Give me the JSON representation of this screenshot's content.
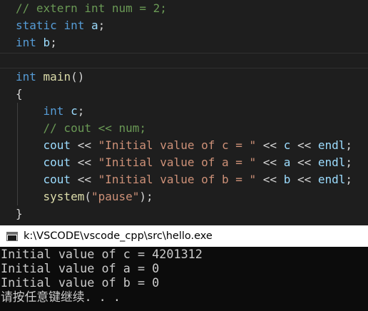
{
  "editor": {
    "lines": [
      {
        "tokens": [
          {
            "t": "// extern int num = 2;",
            "c": "cmt"
          }
        ]
      },
      {
        "tokens": [
          {
            "t": "static",
            "c": "kw"
          },
          {
            "t": " ",
            "c": "pun"
          },
          {
            "t": "int",
            "c": "kw"
          },
          {
            "t": " ",
            "c": "pun"
          },
          {
            "t": "a",
            "c": "var"
          },
          {
            "t": ";",
            "c": "pun"
          }
        ]
      },
      {
        "tokens": [
          {
            "t": "int",
            "c": "kw"
          },
          {
            "t": " ",
            "c": "pun"
          },
          {
            "t": "b",
            "c": "var"
          },
          {
            "t": ";",
            "c": "pun"
          }
        ]
      },
      {
        "tokens": []
      },
      {
        "tokens": [
          {
            "t": "int",
            "c": "kw"
          },
          {
            "t": " ",
            "c": "pun"
          },
          {
            "t": "main",
            "c": "fn"
          },
          {
            "t": "()",
            "c": "pun"
          }
        ]
      },
      {
        "tokens": [
          {
            "t": "{",
            "c": "pun"
          }
        ]
      },
      {
        "tokens": [
          {
            "t": "    ",
            "c": "pun"
          },
          {
            "t": "int",
            "c": "kw"
          },
          {
            "t": " ",
            "c": "pun"
          },
          {
            "t": "c",
            "c": "var"
          },
          {
            "t": ";",
            "c": "pun"
          }
        ]
      },
      {
        "tokens": [
          {
            "t": "    ",
            "c": "pun"
          },
          {
            "t": "// cout << num;",
            "c": "cmt"
          }
        ]
      },
      {
        "tokens": [
          {
            "t": "    ",
            "c": "pun"
          },
          {
            "t": "cout",
            "c": "var"
          },
          {
            "t": " << ",
            "c": "pun"
          },
          {
            "t": "\"Initial value of c = \"",
            "c": "str"
          },
          {
            "t": " << ",
            "c": "pun"
          },
          {
            "t": "c",
            "c": "var"
          },
          {
            "t": " << ",
            "c": "pun"
          },
          {
            "t": "endl",
            "c": "var"
          },
          {
            "t": ";",
            "c": "pun"
          }
        ]
      },
      {
        "tokens": [
          {
            "t": "    ",
            "c": "pun"
          },
          {
            "t": "cout",
            "c": "var"
          },
          {
            "t": " << ",
            "c": "pun"
          },
          {
            "t": "\"Initial value of a = \"",
            "c": "str"
          },
          {
            "t": " << ",
            "c": "pun"
          },
          {
            "t": "a",
            "c": "var"
          },
          {
            "t": " << ",
            "c": "pun"
          },
          {
            "t": "endl",
            "c": "var"
          },
          {
            "t": ";",
            "c": "pun"
          }
        ]
      },
      {
        "tokens": [
          {
            "t": "    ",
            "c": "pun"
          },
          {
            "t": "cout",
            "c": "var"
          },
          {
            "t": " << ",
            "c": "pun"
          },
          {
            "t": "\"Initial value of b = \"",
            "c": "str"
          },
          {
            "t": " << ",
            "c": "pun"
          },
          {
            "t": "b",
            "c": "var"
          },
          {
            "t": " << ",
            "c": "pun"
          },
          {
            "t": "endl",
            "c": "var"
          },
          {
            "t": ";",
            "c": "pun"
          }
        ]
      },
      {
        "tokens": [
          {
            "t": "    ",
            "c": "pun"
          },
          {
            "t": "system",
            "c": "fn"
          },
          {
            "t": "(",
            "c": "pun"
          },
          {
            "t": "\"pause\"",
            "c": "str"
          },
          {
            "t": ");",
            "c": "pun"
          }
        ]
      },
      {
        "tokens": [
          {
            "t": "}",
            "c": "pun"
          }
        ]
      }
    ]
  },
  "console": {
    "title": "k:\\VSCODE\\vscode_cpp\\src\\hello.exe",
    "icon": "console-window-icon",
    "output_lines": [
      "Initial value of c = 4201312",
      "Initial value of a = 0",
      "Initial value of b = 0",
      "请按任意键继续. . ."
    ]
  },
  "colors": {
    "editor_bg": "#1e1e1e",
    "keyword": "#569cd6",
    "function": "#dcdcaa",
    "variable": "#9cdcfe",
    "string": "#ce9178",
    "comment": "#6a9955",
    "console_bg": "#0c0c0c",
    "console_text": "#cccccc"
  }
}
